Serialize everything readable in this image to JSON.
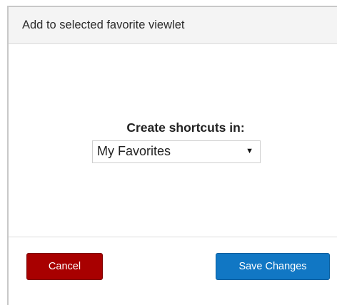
{
  "dialog": {
    "title": "Add to selected favorite viewlet"
  },
  "form": {
    "label": "Create shortcuts in:",
    "selected_value": "My Favorites",
    "arrow_glyph": "▼"
  },
  "footer": {
    "cancel_label": "Cancel",
    "save_label": "Save Changes"
  },
  "colors": {
    "cancel": "#a80000",
    "save": "#1177c4",
    "header_bg": "#f4f4f4"
  }
}
